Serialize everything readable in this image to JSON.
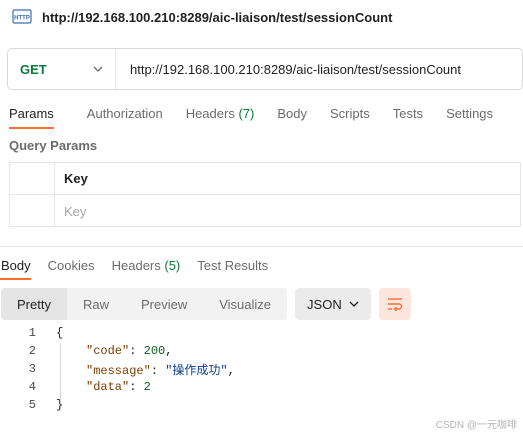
{
  "title_bar": {
    "icon": "http-icon",
    "icon_label": "HTTP",
    "title": "http://192.168.100.210:8289/aic-liaison/test/sessionCount"
  },
  "request": {
    "method": "GET",
    "url": "http://192.168.100.210:8289/aic-liaison/test/sessionCount"
  },
  "request_tabs": [
    {
      "label": "Params",
      "active": true
    },
    {
      "label": "Authorization"
    },
    {
      "label": "Headers",
      "count": "(7)"
    },
    {
      "label": "Body"
    },
    {
      "label": "Scripts"
    },
    {
      "label": "Tests"
    },
    {
      "label": "Settings"
    }
  ],
  "query_params": {
    "section_title": "Query Params",
    "header_key": "Key",
    "placeholder_key": "Key"
  },
  "response_tabs": [
    {
      "label": "Body",
      "active": true
    },
    {
      "label": "Cookies"
    },
    {
      "label": "Headers",
      "count": "(5)"
    },
    {
      "label": "Test Results"
    }
  ],
  "view_modes": [
    {
      "label": "Pretty",
      "active": true
    },
    {
      "label": "Raw"
    },
    {
      "label": "Preview"
    },
    {
      "label": "Visualize"
    }
  ],
  "format_select": "JSON",
  "response_body": {
    "line_numbers": [
      "1",
      "2",
      "3",
      "4",
      "5"
    ],
    "open_brace": "{",
    "close_brace": "}",
    "fields": [
      {
        "key": "\"code\"",
        "value": "200",
        "sep": ","
      },
      {
        "key": "\"message\"",
        "value": "\"操作成功\"",
        "sep": ","
      },
      {
        "key": "\"data\"",
        "value": "2",
        "sep": ""
      }
    ]
  },
  "watermark": "CSDN @一元咖啡",
  "colors": {
    "accent": "#ff6c37",
    "method_get": "#0b7a3e"
  }
}
